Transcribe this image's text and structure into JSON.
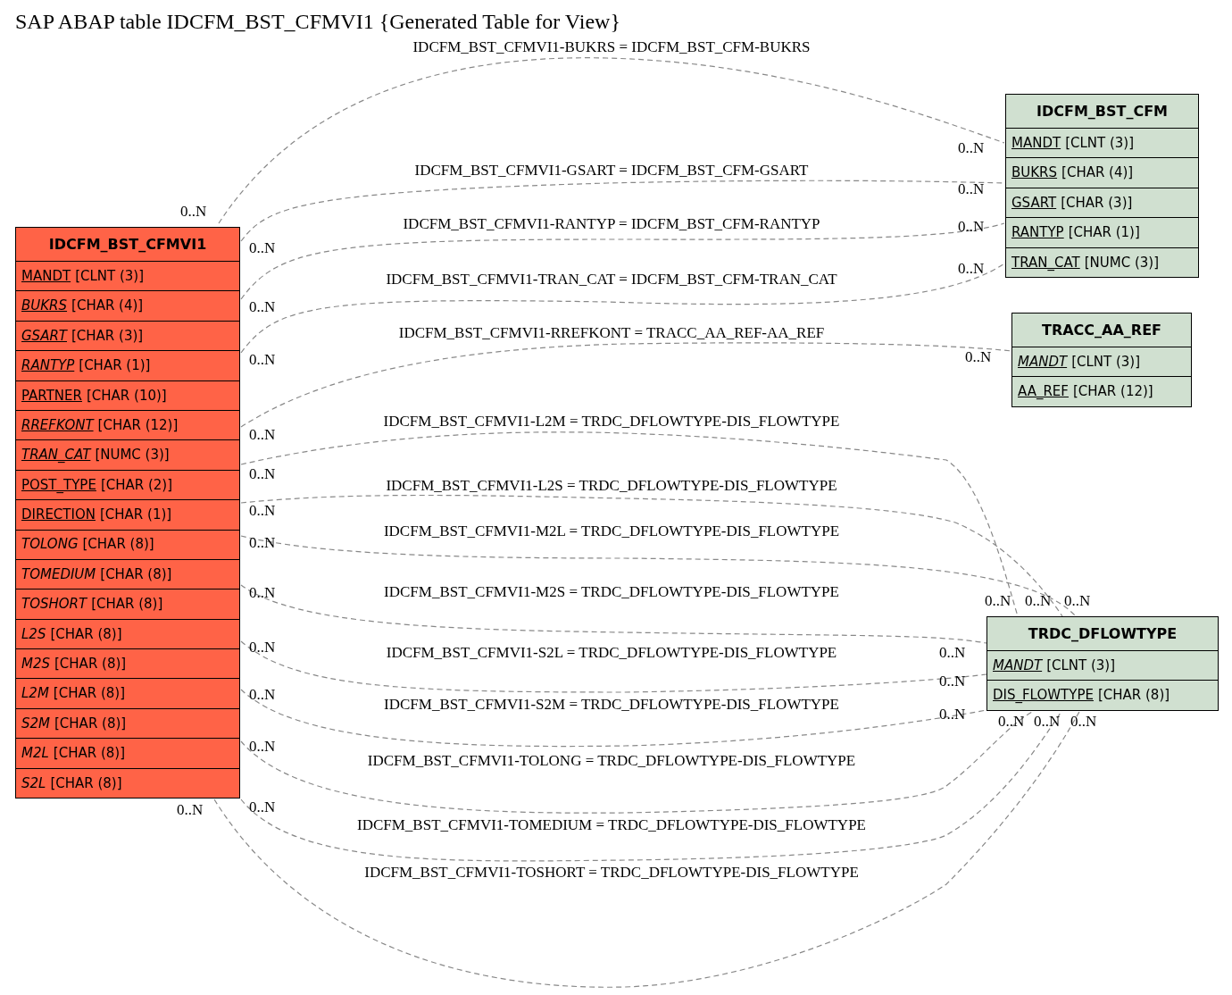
{
  "title": "SAP ABAP table IDCFM_BST_CFMVI1 {Generated Table for View}",
  "tables": [
    {
      "name": "IDCFM_BST_CFMVI1",
      "color": "#ff6347",
      "fields": [
        {
          "name": "MANDT",
          "type": "[CLNT (3)]",
          "key": true,
          "italic": false
        },
        {
          "name": "BUKRS",
          "type": "[CHAR (4)]",
          "key": true,
          "italic": true
        },
        {
          "name": "GSART",
          "type": "[CHAR (3)]",
          "key": true,
          "italic": true
        },
        {
          "name": "RANTYP",
          "type": "[CHAR (1)]",
          "key": true,
          "italic": true
        },
        {
          "name": "PARTNER",
          "type": "[CHAR (10)]",
          "key": true,
          "italic": false
        },
        {
          "name": "RREFKONT",
          "type": "[CHAR (12)]",
          "key": true,
          "italic": true
        },
        {
          "name": "TRAN_CAT",
          "type": "[NUMC (3)]",
          "key": true,
          "italic": true
        },
        {
          "name": "POST_TYPE",
          "type": "[CHAR (2)]",
          "key": true,
          "italic": false
        },
        {
          "name": "DIRECTION",
          "type": "[CHAR (1)]",
          "key": true,
          "italic": false
        },
        {
          "name": "TOLONG",
          "type": "[CHAR (8)]",
          "key": false,
          "italic": true
        },
        {
          "name": "TOMEDIUM",
          "type": "[CHAR (8)]",
          "key": false,
          "italic": true
        },
        {
          "name": "TOSHORT",
          "type": "[CHAR (8)]",
          "key": false,
          "italic": true
        },
        {
          "name": "L2S",
          "type": "[CHAR (8)]",
          "key": false,
          "italic": true
        },
        {
          "name": "M2S",
          "type": "[CHAR (8)]",
          "key": false,
          "italic": true
        },
        {
          "name": "L2M",
          "type": "[CHAR (8)]",
          "key": false,
          "italic": true
        },
        {
          "name": "S2M",
          "type": "[CHAR (8)]",
          "key": false,
          "italic": true
        },
        {
          "name": "M2L",
          "type": "[CHAR (8)]",
          "key": false,
          "italic": true
        },
        {
          "name": "S2L",
          "type": "[CHAR (8)]",
          "key": false,
          "italic": true
        }
      ]
    },
    {
      "name": "IDCFM_BST_CFM",
      "color": "#d0e0d0",
      "fields": [
        {
          "name": "MANDT",
          "type": "[CLNT (3)]",
          "key": true,
          "italic": false
        },
        {
          "name": "BUKRS",
          "type": "[CHAR (4)]",
          "key": true,
          "italic": false
        },
        {
          "name": "GSART",
          "type": "[CHAR (3)]",
          "key": true,
          "italic": false
        },
        {
          "name": "RANTYP",
          "type": "[CHAR (1)]",
          "key": true,
          "italic": false
        },
        {
          "name": "TRAN_CAT",
          "type": "[NUMC (3)]",
          "key": true,
          "italic": false
        }
      ]
    },
    {
      "name": "TRACC_AA_REF",
      "color": "#d0e0d0",
      "fields": [
        {
          "name": "MANDT",
          "type": "[CLNT (3)]",
          "key": true,
          "italic": true
        },
        {
          "name": "AA_REF",
          "type": "[CHAR (12)]",
          "key": true,
          "italic": false
        }
      ]
    },
    {
      "name": "TRDC_DFLOWTYPE",
      "color": "#d0e0d0",
      "fields": [
        {
          "name": "MANDT",
          "type": "[CLNT (3)]",
          "key": true,
          "italic": true
        },
        {
          "name": "DIS_FLOWTYPE",
          "type": "[CHAR (8)]",
          "key": true,
          "italic": false
        }
      ]
    }
  ],
  "relations": [
    {
      "label": "IDCFM_BST_CFMVI1-BUKRS = IDCFM_BST_CFM-BUKRS",
      "from_card": "0..N",
      "to_card": "0..N"
    },
    {
      "label": "IDCFM_BST_CFMVI1-GSART = IDCFM_BST_CFM-GSART",
      "from_card": "0..N",
      "to_card": "0..N"
    },
    {
      "label": "IDCFM_BST_CFMVI1-RANTYP = IDCFM_BST_CFM-RANTYP",
      "from_card": "0..N",
      "to_card": "0..N"
    },
    {
      "label": "IDCFM_BST_CFMVI1-TRAN_CAT = IDCFM_BST_CFM-TRAN_CAT",
      "from_card": "0..N",
      "to_card": "0..N"
    },
    {
      "label": "IDCFM_BST_CFMVI1-RREFKONT = TRACC_AA_REF-AA_REF",
      "from_card": "0..N",
      "to_card": "0..N"
    },
    {
      "label": "IDCFM_BST_CFMVI1-L2M = TRDC_DFLOWTYPE-DIS_FLOWTYPE",
      "from_card": "0..N",
      "to_card": "0..N"
    },
    {
      "label": "IDCFM_BST_CFMVI1-L2S = TRDC_DFLOWTYPE-DIS_FLOWTYPE",
      "from_card": "0..N",
      "to_card": "0..N"
    },
    {
      "label": "IDCFM_BST_CFMVI1-M2L = TRDC_DFLOWTYPE-DIS_FLOWTYPE",
      "from_card": "0..N",
      "to_card": "0..N"
    },
    {
      "label": "IDCFM_BST_CFMVI1-M2S = TRDC_DFLOWTYPE-DIS_FLOWTYPE",
      "from_card": "0..N",
      "to_card": "0..N"
    },
    {
      "label": "IDCFM_BST_CFMVI1-S2L = TRDC_DFLOWTYPE-DIS_FLOWTYPE",
      "from_card": "0..N",
      "to_card": "0..N"
    },
    {
      "label": "IDCFM_BST_CFMVI1-S2M = TRDC_DFLOWTYPE-DIS_FLOWTYPE",
      "from_card": "0..N",
      "to_card": "0..N"
    },
    {
      "label": "IDCFM_BST_CFMVI1-TOLONG = TRDC_DFLOWTYPE-DIS_FLOWTYPE",
      "from_card": "0..N",
      "to_card": "0..N"
    },
    {
      "label": "IDCFM_BST_CFMVI1-TOMEDIUM = TRDC_DFLOWTYPE-DIS_FLOWTYPE",
      "from_card": "0..N",
      "to_card": "0..N"
    },
    {
      "label": "IDCFM_BST_CFMVI1-TOSHORT = TRDC_DFLOWTYPE-DIS_FLOWTYPE",
      "from_card": "0..N",
      "to_card": "0..N"
    }
  ]
}
